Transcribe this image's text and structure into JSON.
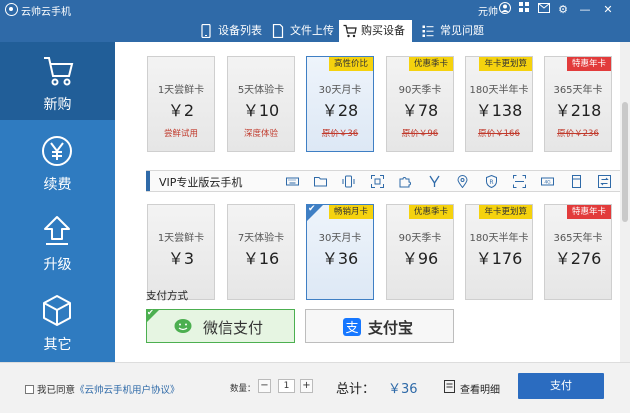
{
  "app": {
    "title": "云帅云手机",
    "user": "元帅",
    "controls": [
      "user",
      "grid",
      "mail",
      "settings",
      "minimize",
      "close"
    ]
  },
  "tabs": [
    {
      "label": "设备列表",
      "icon": "phone-icon"
    },
    {
      "label": "文件上传",
      "icon": "file-icon"
    },
    {
      "label": "购买设备",
      "icon": "cart-icon",
      "active": true
    },
    {
      "label": "常见问题",
      "icon": "list-icon"
    }
  ],
  "sidebar": [
    {
      "label": "新购",
      "icon": "cart-icon",
      "active": true
    },
    {
      "label": "续费",
      "icon": "yen-icon"
    },
    {
      "label": "升级",
      "icon": "arrow-up-icon"
    },
    {
      "label": "其它",
      "icon": "cube-icon"
    }
  ],
  "plans_top": [
    {
      "name": "1天尝鲜卡",
      "price": "￥2",
      "sub": "尝鲜试用",
      "badge": ""
    },
    {
      "name": "5天体验卡",
      "price": "￥10",
      "sub": "深度体验",
      "badge": ""
    },
    {
      "name": "30天月卡",
      "price": "￥28",
      "sub": "原价￥36",
      "badge": "高性价比",
      "selected": true
    },
    {
      "name": "90天季卡",
      "price": "￥78",
      "sub": "原价￥96",
      "badge": "优惠季卡"
    },
    {
      "name": "180天半年卡",
      "price": "￥138",
      "sub": "原价￥166",
      "badge": "年卡更划算"
    },
    {
      "name": "365天年卡",
      "price": "￥218",
      "sub": "原价￥236",
      "badge": "特惠年卡",
      "badge_red": true
    }
  ],
  "vip": {
    "title": "VIP专业版云手机",
    "feature_icons": [
      "keyboard-icon",
      "folder-icon",
      "vibrate-icon",
      "screenshot-icon",
      "puzzle-icon",
      "script-icon",
      "location-icon",
      "shield-icon",
      "scan-icon",
      "camera-icon",
      "tablet-icon",
      "sync-icon"
    ]
  },
  "plans_vip": [
    {
      "name": "1天尝鲜卡",
      "price": "￥3",
      "badge": ""
    },
    {
      "name": "7天体验卡",
      "price": "￥16",
      "badge": ""
    },
    {
      "name": "30天月卡",
      "price": "￥36",
      "badge": "畅销月卡",
      "selected": true
    },
    {
      "name": "90天季卡",
      "price": "￥96",
      "badge": "优惠季卡"
    },
    {
      "name": "180天半年卡",
      "price": "￥176",
      "badge": "年卡更划算"
    },
    {
      "name": "365天年卡",
      "price": "￥276",
      "badge": "特惠年卡",
      "badge_red": true
    }
  ],
  "payment": {
    "label": "支付方式",
    "wechat": "微信支付",
    "alipay": "支付宝"
  },
  "footer": {
    "agree_prefix": "我已同意",
    "agree_link": "《云帅云手机用户协议》",
    "qty_label": "数量：",
    "qty_value": "1",
    "minus": "−",
    "plus": "+",
    "total_label": "总计：",
    "total_value": "￥36",
    "detail": "查看明细",
    "pay": "支付"
  },
  "colors": {
    "brand": "#2f6aa8",
    "sidebar": "#2f7bc0",
    "sidebar_active": "#215e98",
    "badge_yellow": "#f5d20e",
    "badge_red": "#e23b3b",
    "wechat_green": "#4caf50",
    "alipay_blue": "#1677ff"
  }
}
